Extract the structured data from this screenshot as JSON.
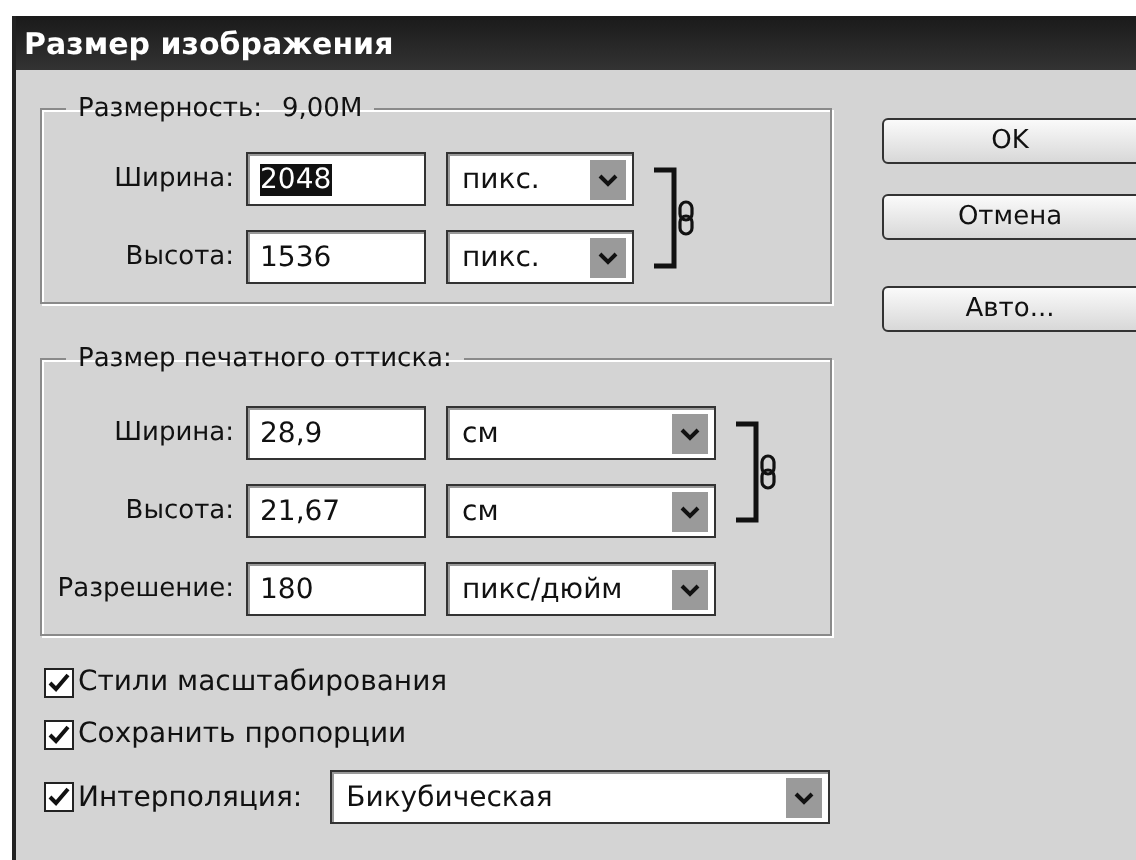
{
  "window": {
    "title": "Размер изображения"
  },
  "pixel_dimensions": {
    "legend": "Размерность:",
    "value": "9,00M",
    "fields": [
      {
        "label": "Ширина:",
        "value": "2048",
        "highlighted": true,
        "unit": "пикс."
      },
      {
        "label": "Высота:",
        "value": "1536",
        "highlighted": false,
        "unit": "пикс."
      }
    ]
  },
  "document_size": {
    "legend": "Размер печатного оттиска:",
    "fields": [
      {
        "label": "Ширина:",
        "value": "28,9",
        "highlighted": false,
        "unit": "см"
      },
      {
        "label": "Высота:",
        "value": "21,67",
        "highlighted": false,
        "unit": "см"
      },
      {
        "label": "Разрешение:",
        "value": "180",
        "highlighted": false,
        "unit": "пикс/дюйм"
      }
    ]
  },
  "options": [
    {
      "kind": "checkbox",
      "label": "Стили масштабирования",
      "checked": true
    },
    {
      "kind": "checkbox",
      "label": "Сохранить пропорции",
      "checked": true
    },
    {
      "kind": "select",
      "label": "Интерполяция:",
      "checked": true,
      "value": "Бикубическая"
    }
  ],
  "buttons": [
    "OK",
    "Отмена",
    "Авто..."
  ]
}
